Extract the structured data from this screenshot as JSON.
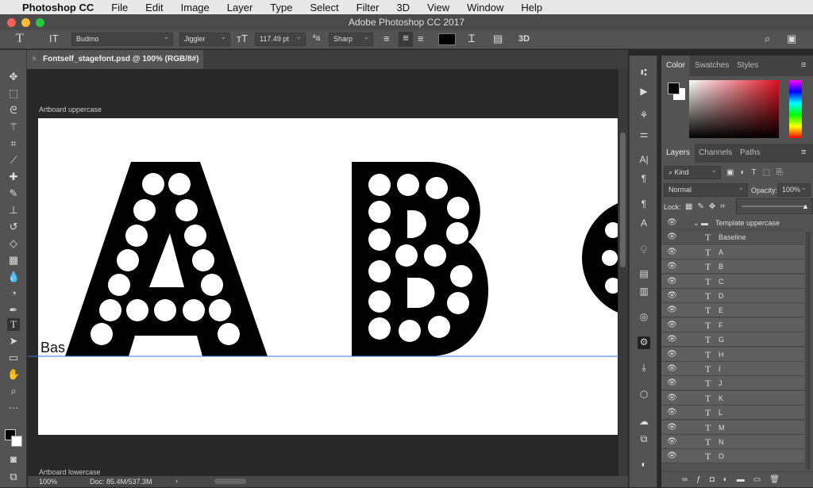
{
  "menubar": {
    "app": "Photoshop CC",
    "items": [
      "File",
      "Edit",
      "Image",
      "Layer",
      "Type",
      "Select",
      "Filter",
      "3D",
      "View",
      "Window",
      "Help"
    ]
  },
  "window_title": "Adobe Photoshop CC 2017",
  "options": {
    "font_family": "Budmo",
    "font_style": "Jiggler",
    "font_size": "117.49 pt",
    "antialias": "Sharp",
    "color": "#000000",
    "threed": "3D"
  },
  "document_tab": "Fontself_stagefont.psd @ 100% (RGB/8#) *",
  "canvas": {
    "artboard_top": "Artboard uppercase",
    "artboard_bottom": "Artboard lowercase",
    "baseline_text": "Bas"
  },
  "status": {
    "zoom": "100%",
    "doc": "Doc: 85.4M/537.3M"
  },
  "color_panel": {
    "tabs": [
      "Color",
      "Swatches",
      "Styles"
    ],
    "active": "Color"
  },
  "layers_panel": {
    "tabs": [
      "Layers",
      "Channels",
      "Paths"
    ],
    "active": "Layers",
    "filter": "Kind",
    "blend_mode": "Normal",
    "opacity_label": "Opacity:",
    "opacity": "100%",
    "lock_label": "Lock:",
    "group": "Template uppercase",
    "layers": [
      "Baseline",
      "A",
      "B",
      "C",
      "D",
      "E",
      "F",
      "G",
      "H",
      "I",
      "J",
      "K",
      "L",
      "M",
      "N",
      "O"
    ]
  }
}
